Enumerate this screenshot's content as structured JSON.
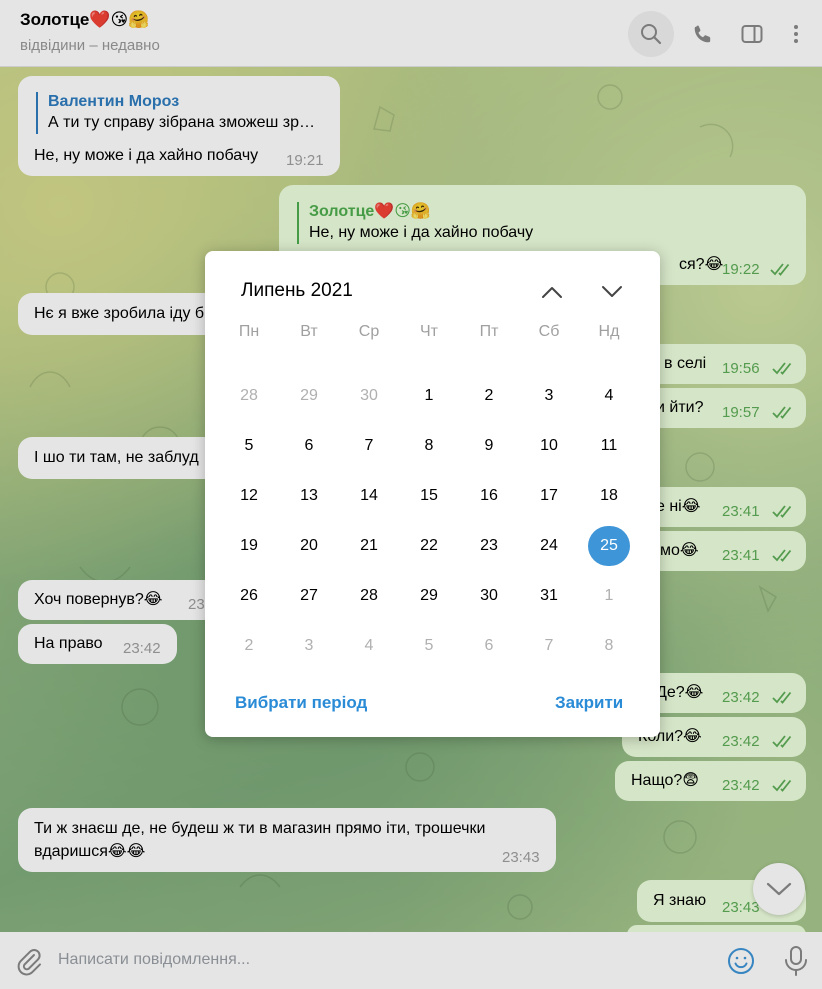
{
  "header": {
    "title": "Золотце❤️😘🤗",
    "status": "відвідини – недавно",
    "icons": [
      "search-icon",
      "phone-icon",
      "sidebar-icon",
      "more-vert-icon"
    ]
  },
  "messages": [
    {
      "id": "m1",
      "dir": "in",
      "quote_author": "Валентин Мороз",
      "quote_text": "А ти ту справу зібрана зможеш зр…",
      "text": "Не, ну може і да хайно побачу",
      "time": "19:21"
    },
    {
      "id": "m2",
      "dir": "out",
      "quote_author": "Золотце❤️😘🤗",
      "quote_text": "Не, ну може і да хайно побачу",
      "text": "ся?😂",
      "time": "19:22",
      "read": true
    },
    {
      "id": "m3",
      "dir": "in",
      "text": "Нє я вже зробила іду б",
      "time": ""
    },
    {
      "id": "m4",
      "dir": "out",
      "text": "в селі",
      "time": "19:56",
      "read": true
    },
    {
      "id": "m5",
      "dir": "out",
      "text": "и йти?",
      "time": "19:57",
      "read": true
    },
    {
      "id": "m6",
      "dir": "in",
      "text": "І шо ти там, не заблуд",
      "time": ""
    },
    {
      "id": "m7",
      "dir": "out",
      "text": "е ні😂",
      "time": "23:41",
      "read": true
    },
    {
      "id": "m8",
      "dir": "out",
      "text": "мо😂",
      "time": "23:41",
      "read": true
    },
    {
      "id": "m9",
      "dir": "in",
      "text": "Хоч повернув?😂",
      "time": "23"
    },
    {
      "id": "m10",
      "dir": "in",
      "text": "На право",
      "time": "23:42"
    },
    {
      "id": "m11",
      "dir": "out",
      "text": "Де?😂",
      "time": "23:42",
      "read": true
    },
    {
      "id": "m12",
      "dir": "out",
      "text": "Коли?😂",
      "time": "23:42",
      "read": true
    },
    {
      "id": "m13",
      "dir": "out",
      "text": "Нащо?😨",
      "time": "23:42",
      "read": true
    },
    {
      "id": "m14",
      "dir": "in",
      "line1": "Ти ж знаєш де, не будеш ж ти в магазин прямо іти, трошечки",
      "line2": "вдаришся😂😂",
      "time": "23:43"
    },
    {
      "id": "m15",
      "dir": "out",
      "text": "Я знаю",
      "time": "23:43"
    }
  ],
  "composer": {
    "placeholder": "Написати повідомлення...",
    "icons": [
      "attach-icon",
      "emoji-icon",
      "mic-icon"
    ]
  },
  "scroll_down_icon": "chevron-down-icon",
  "calendar": {
    "month_title": "Липень 2021",
    "weekdays": [
      "Пн",
      "Вт",
      "Ср",
      "Чт",
      "Пт",
      "Сб",
      "Нд"
    ],
    "weeks": [
      [
        {
          "d": "28",
          "other": true
        },
        {
          "d": "29",
          "other": true
        },
        {
          "d": "30",
          "other": true
        },
        {
          "d": "1"
        },
        {
          "d": "2"
        },
        {
          "d": "3"
        },
        {
          "d": "4"
        }
      ],
      [
        {
          "d": "5"
        },
        {
          "d": "6"
        },
        {
          "d": "7"
        },
        {
          "d": "8"
        },
        {
          "d": "9"
        },
        {
          "d": "10"
        },
        {
          "d": "11"
        }
      ],
      [
        {
          "d": "12"
        },
        {
          "d": "13"
        },
        {
          "d": "14"
        },
        {
          "d": "15"
        },
        {
          "d": "16"
        },
        {
          "d": "17"
        },
        {
          "d": "18"
        }
      ],
      [
        {
          "d": "19"
        },
        {
          "d": "20"
        },
        {
          "d": "21"
        },
        {
          "d": "22"
        },
        {
          "d": "23"
        },
        {
          "d": "24"
        },
        {
          "d": "25",
          "selected": true
        }
      ],
      [
        {
          "d": "26"
        },
        {
          "d": "27"
        },
        {
          "d": "28"
        },
        {
          "d": "29"
        },
        {
          "d": "30"
        },
        {
          "d": "31"
        },
        {
          "d": "1",
          "other": true
        }
      ],
      [
        {
          "d": "2",
          "other": true
        },
        {
          "d": "3",
          "other": true
        },
        {
          "d": "4",
          "other": true
        },
        {
          "d": "5",
          "other": true
        },
        {
          "d": "6",
          "other": true
        },
        {
          "d": "7",
          "other": true
        },
        {
          "d": "8",
          "other": true
        }
      ]
    ],
    "select_period_label": "Вибрати період",
    "close_label": "Закрити",
    "prev_icon": "chevron-up-icon",
    "next_icon": "chevron-down-icon"
  },
  "colors": {
    "accent": "#3e95d7",
    "link": "#2a8bd6",
    "outgoing_bubble": "#eeffde",
    "outgoing_time": "#5dad57",
    "quote_in": "#2e7cbf",
    "quote_out": "#4fae4e"
  }
}
